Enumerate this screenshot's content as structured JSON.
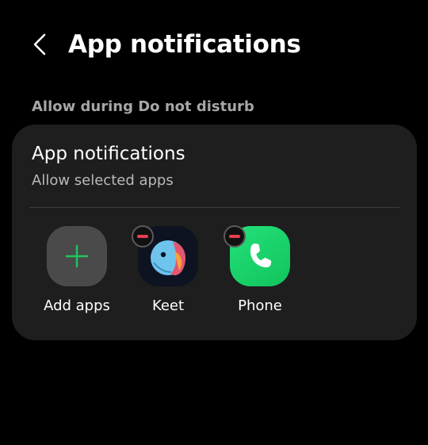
{
  "header": {
    "title": "App notifications"
  },
  "section": {
    "label": "Allow during Do not disturb"
  },
  "card": {
    "title": "App notifications",
    "subtitle": "Allow selected apps",
    "apps": [
      {
        "label": "Add apps",
        "icon": "plus-icon"
      },
      {
        "label": "Keet",
        "icon": "keet-app-icon",
        "removable": true
      },
      {
        "label": "Phone",
        "icon": "phone-app-icon",
        "removable": true
      }
    ]
  },
  "colors": {
    "background": "#000000",
    "card": "#1e1e1e",
    "accent_green": "#22c55e",
    "remove_red": "#e5414d"
  }
}
